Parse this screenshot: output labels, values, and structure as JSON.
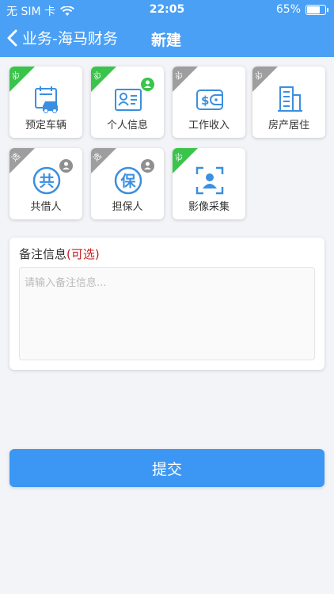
{
  "status_bar": {
    "carrier": "无 SIM 卡",
    "time": "22:05",
    "battery": "65%",
    "battery_level": 0.65
  },
  "nav": {
    "back_label": "业务-海马财务",
    "title": "新建"
  },
  "tiles": [
    {
      "label": "预定车辆",
      "badge": "必",
      "badge_color": "#3bc44b",
      "icon": "car-calendar-icon"
    },
    {
      "label": "个人信息",
      "badge": "必",
      "badge_color": "#3bc44b",
      "icon": "id-card-icon",
      "status": "completed"
    },
    {
      "label": "工作收入",
      "badge": "必",
      "badge_color": "#9e9e9e",
      "icon": "wallet-icon"
    },
    {
      "label": "房产居住",
      "badge": "必",
      "badge_color": "#9e9e9e",
      "icon": "building-icon"
    },
    {
      "label": "共借人",
      "badge": "选",
      "badge_color": "#9e9e9e",
      "icon": "co-borrower-icon",
      "glyph": "共",
      "status": "pending"
    },
    {
      "label": "担保人",
      "badge": "选",
      "badge_color": "#9e9e9e",
      "icon": "guarantor-icon",
      "glyph": "保",
      "status": "pending"
    },
    {
      "label": "影像采集",
      "badge": "必",
      "badge_color": "#3bc44b",
      "icon": "face-scan-icon"
    }
  ],
  "remarks": {
    "title": "备注信息",
    "optional": "(可选)",
    "placeholder": "请输入备注信息..."
  },
  "submit_label": "提交",
  "colors": {
    "primary": "#4aa0f5",
    "required_done": "#3bc44b",
    "inactive": "#9e9e9e"
  }
}
